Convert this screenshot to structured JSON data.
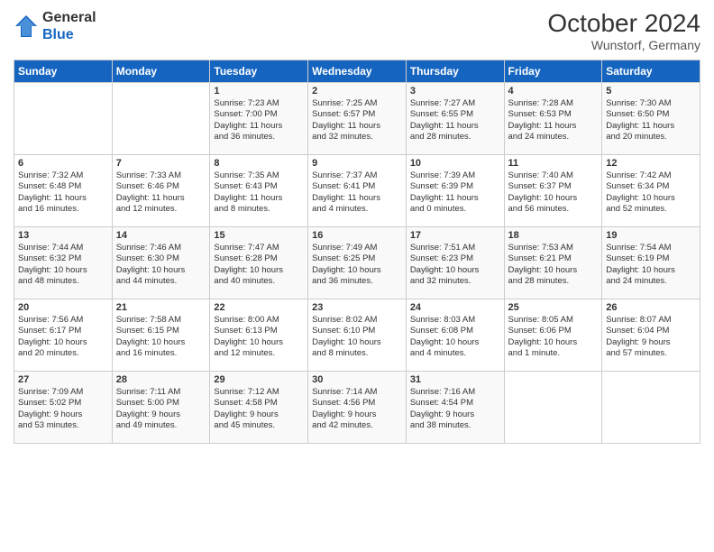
{
  "header": {
    "logo_line1": "General",
    "logo_line2": "Blue",
    "month": "October 2024",
    "location": "Wunstorf, Germany"
  },
  "days_of_week": [
    "Sunday",
    "Monday",
    "Tuesday",
    "Wednesday",
    "Thursday",
    "Friday",
    "Saturday"
  ],
  "weeks": [
    [
      {
        "day": "",
        "info": ""
      },
      {
        "day": "",
        "info": ""
      },
      {
        "day": "1",
        "info": "Sunrise: 7:23 AM\nSunset: 7:00 PM\nDaylight: 11 hours\nand 36 minutes."
      },
      {
        "day": "2",
        "info": "Sunrise: 7:25 AM\nSunset: 6:57 PM\nDaylight: 11 hours\nand 32 minutes."
      },
      {
        "day": "3",
        "info": "Sunrise: 7:27 AM\nSunset: 6:55 PM\nDaylight: 11 hours\nand 28 minutes."
      },
      {
        "day": "4",
        "info": "Sunrise: 7:28 AM\nSunset: 6:53 PM\nDaylight: 11 hours\nand 24 minutes."
      },
      {
        "day": "5",
        "info": "Sunrise: 7:30 AM\nSunset: 6:50 PM\nDaylight: 11 hours\nand 20 minutes."
      }
    ],
    [
      {
        "day": "6",
        "info": "Sunrise: 7:32 AM\nSunset: 6:48 PM\nDaylight: 11 hours\nand 16 minutes."
      },
      {
        "day": "7",
        "info": "Sunrise: 7:33 AM\nSunset: 6:46 PM\nDaylight: 11 hours\nand 12 minutes."
      },
      {
        "day": "8",
        "info": "Sunrise: 7:35 AM\nSunset: 6:43 PM\nDaylight: 11 hours\nand 8 minutes."
      },
      {
        "day": "9",
        "info": "Sunrise: 7:37 AM\nSunset: 6:41 PM\nDaylight: 11 hours\nand 4 minutes."
      },
      {
        "day": "10",
        "info": "Sunrise: 7:39 AM\nSunset: 6:39 PM\nDaylight: 11 hours\nand 0 minutes."
      },
      {
        "day": "11",
        "info": "Sunrise: 7:40 AM\nSunset: 6:37 PM\nDaylight: 10 hours\nand 56 minutes."
      },
      {
        "day": "12",
        "info": "Sunrise: 7:42 AM\nSunset: 6:34 PM\nDaylight: 10 hours\nand 52 minutes."
      }
    ],
    [
      {
        "day": "13",
        "info": "Sunrise: 7:44 AM\nSunset: 6:32 PM\nDaylight: 10 hours\nand 48 minutes."
      },
      {
        "day": "14",
        "info": "Sunrise: 7:46 AM\nSunset: 6:30 PM\nDaylight: 10 hours\nand 44 minutes."
      },
      {
        "day": "15",
        "info": "Sunrise: 7:47 AM\nSunset: 6:28 PM\nDaylight: 10 hours\nand 40 minutes."
      },
      {
        "day": "16",
        "info": "Sunrise: 7:49 AM\nSunset: 6:25 PM\nDaylight: 10 hours\nand 36 minutes."
      },
      {
        "day": "17",
        "info": "Sunrise: 7:51 AM\nSunset: 6:23 PM\nDaylight: 10 hours\nand 32 minutes."
      },
      {
        "day": "18",
        "info": "Sunrise: 7:53 AM\nSunset: 6:21 PM\nDaylight: 10 hours\nand 28 minutes."
      },
      {
        "day": "19",
        "info": "Sunrise: 7:54 AM\nSunset: 6:19 PM\nDaylight: 10 hours\nand 24 minutes."
      }
    ],
    [
      {
        "day": "20",
        "info": "Sunrise: 7:56 AM\nSunset: 6:17 PM\nDaylight: 10 hours\nand 20 minutes."
      },
      {
        "day": "21",
        "info": "Sunrise: 7:58 AM\nSunset: 6:15 PM\nDaylight: 10 hours\nand 16 minutes."
      },
      {
        "day": "22",
        "info": "Sunrise: 8:00 AM\nSunset: 6:13 PM\nDaylight: 10 hours\nand 12 minutes."
      },
      {
        "day": "23",
        "info": "Sunrise: 8:02 AM\nSunset: 6:10 PM\nDaylight: 10 hours\nand 8 minutes."
      },
      {
        "day": "24",
        "info": "Sunrise: 8:03 AM\nSunset: 6:08 PM\nDaylight: 10 hours\nand 4 minutes."
      },
      {
        "day": "25",
        "info": "Sunrise: 8:05 AM\nSunset: 6:06 PM\nDaylight: 10 hours\nand 1 minute."
      },
      {
        "day": "26",
        "info": "Sunrise: 8:07 AM\nSunset: 6:04 PM\nDaylight: 9 hours\nand 57 minutes."
      }
    ],
    [
      {
        "day": "27",
        "info": "Sunrise: 7:09 AM\nSunset: 5:02 PM\nDaylight: 9 hours\nand 53 minutes."
      },
      {
        "day": "28",
        "info": "Sunrise: 7:11 AM\nSunset: 5:00 PM\nDaylight: 9 hours\nand 49 minutes."
      },
      {
        "day": "29",
        "info": "Sunrise: 7:12 AM\nSunset: 4:58 PM\nDaylight: 9 hours\nand 45 minutes."
      },
      {
        "day": "30",
        "info": "Sunrise: 7:14 AM\nSunset: 4:56 PM\nDaylight: 9 hours\nand 42 minutes."
      },
      {
        "day": "31",
        "info": "Sunrise: 7:16 AM\nSunset: 4:54 PM\nDaylight: 9 hours\nand 38 minutes."
      },
      {
        "day": "",
        "info": ""
      },
      {
        "day": "",
        "info": ""
      }
    ]
  ]
}
